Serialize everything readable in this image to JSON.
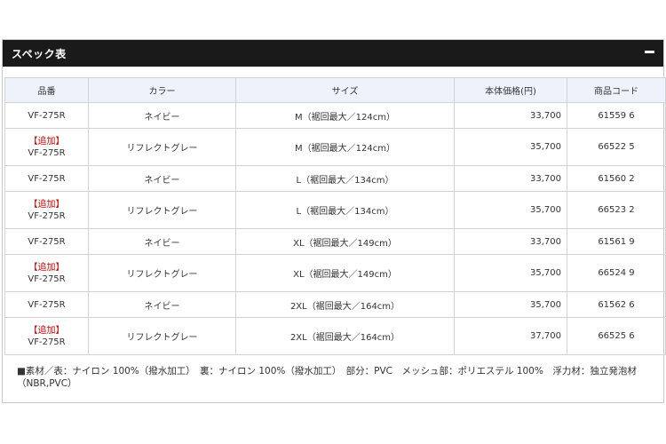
{
  "section": {
    "title": "スペック表",
    "toggle": "−"
  },
  "table": {
    "headers": [
      "品番",
      "カラー",
      "サイズ",
      "本体価格(円)",
      "商品コード"
    ],
    "rows": [
      {
        "tag": "",
        "model": "VF-275R",
        "color": "ネイビー",
        "size": "M（裾回最大／124cm）",
        "price": "33,700",
        "code": "61559 6"
      },
      {
        "tag": "【追加】",
        "model": "VF-275R",
        "color": "リフレクトグレー",
        "size": "M（裾回最大／124cm）",
        "price": "35,700",
        "code": "66522 5"
      },
      {
        "tag": "",
        "model": "VF-275R",
        "color": "ネイビー",
        "size": "L（裾回最大／134cm）",
        "price": "33,700",
        "code": "61560 2"
      },
      {
        "tag": "【追加】",
        "model": "VF-275R",
        "color": "リフレクトグレー",
        "size": "L（裾回最大／134cm）",
        "price": "35,700",
        "code": "66523 2"
      },
      {
        "tag": "",
        "model": "VF-275R",
        "color": "ネイビー",
        "size": "XL（裾回最大／149cm）",
        "price": "33,700",
        "code": "61561 9"
      },
      {
        "tag": "【追加】",
        "model": "VF-275R",
        "color": "リフレクトグレー",
        "size": "XL（裾回最大／149cm）",
        "price": "35,700",
        "code": "66524 9"
      },
      {
        "tag": "",
        "model": "VF-275R",
        "color": "ネイビー",
        "size": "2XL（裾回最大／164cm）",
        "price": "35,700",
        "code": "61562 6"
      },
      {
        "tag": "【追加】",
        "model": "VF-275R",
        "color": "リフレクトグレー",
        "size": "2XL（裾回最大／164cm）",
        "price": "37,700",
        "code": "66525 6"
      }
    ]
  },
  "note": "■素材／表：ナイロン 100%（撥水加工）　裏：ナイロン 100%（撥水加工）　部分：PVC　メッシュ部：ポリエステル 100%　浮力材：独立発泡材（NBR,PVC）",
  "colors": {
    "header_bg": "#1a1a1a",
    "th_bg": "#eef3fb",
    "tag": "#d20000",
    "border": "#d2d2d2"
  }
}
